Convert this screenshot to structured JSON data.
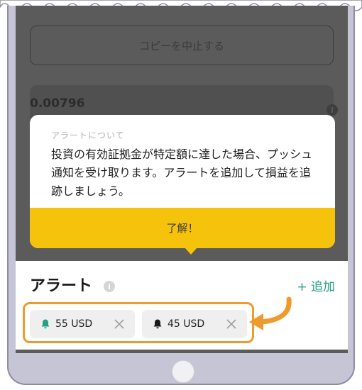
{
  "screen": {
    "copy_stop_label": "コピーを中止する",
    "value": "0.00796"
  },
  "tooltip": {
    "title": "アラートについて",
    "body": "投資の有効証拠金が特定額に達した場合、プッシュ通知を受け取ります。アラートを追加して損益を追跡しましょう。",
    "ok_label": "了解！"
  },
  "alerts": {
    "heading": "アラート",
    "add_label": "+ 追加",
    "items": [
      {
        "label": "55 USD",
        "icon": "bell-icon",
        "icon_color": "#23a085"
      },
      {
        "label": "45 USD",
        "icon": "bell-icon",
        "icon_color": "#1a1a1a"
      }
    ]
  },
  "colors": {
    "accent_yellow": "#f6c30c",
    "accent_green": "#23a085",
    "highlight_orange": "#ee9b2e"
  }
}
